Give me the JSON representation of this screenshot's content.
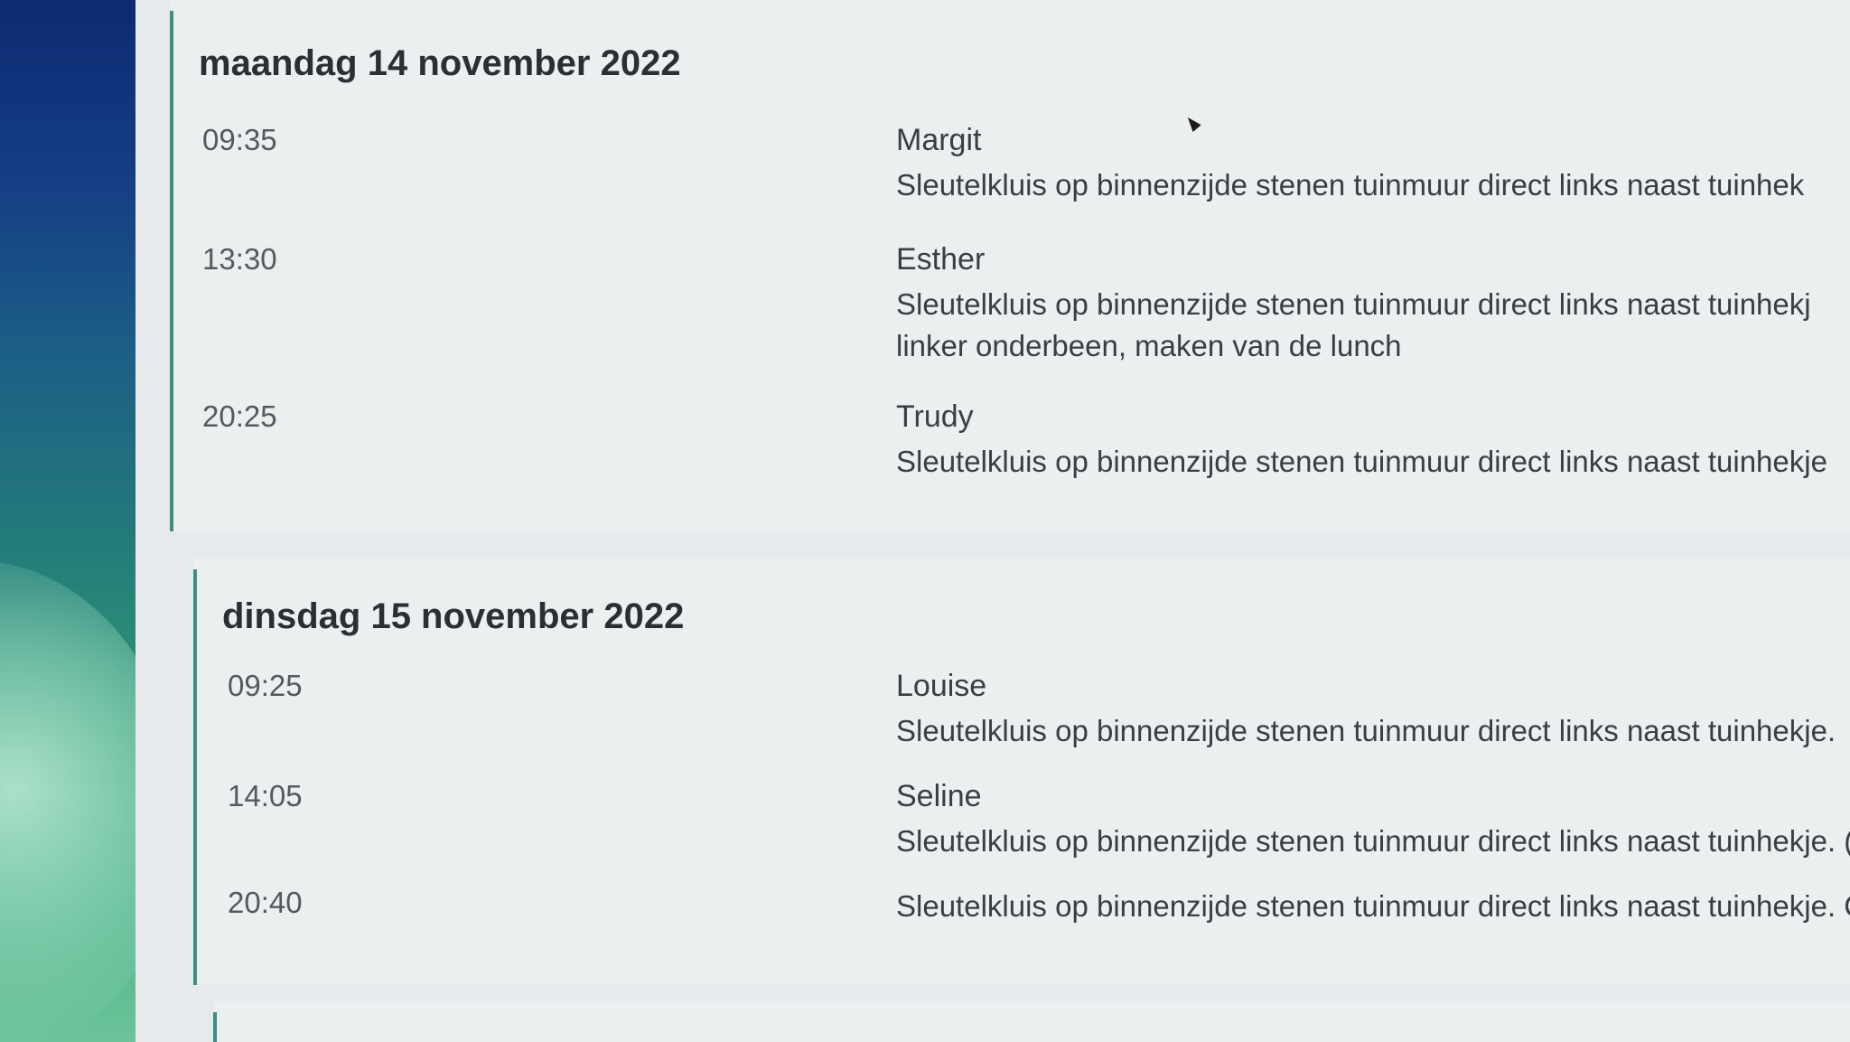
{
  "days": [
    {
      "title": "maandag 14 november 2022",
      "appointments": [
        {
          "time": "09:35",
          "name": "Margit",
          "lines": [
            "Sleutelkluis op binnenzijde stenen tuinmuur direct links naast tuinhek"
          ]
        },
        {
          "time": "13:30",
          "name": "Esther",
          "lines": [
            "Sleutelkluis op binnenzijde stenen tuinmuur direct links naast tuinhekj",
            "linker onderbeen, maken van de lunch"
          ]
        },
        {
          "time": "20:25",
          "name": "Trudy",
          "lines": [
            "Sleutelkluis op binnenzijde stenen tuinmuur direct links naast tuinhekje"
          ]
        }
      ]
    },
    {
      "title": "dinsdag 15 november 2022",
      "appointments": [
        {
          "time": "09:25",
          "name": "Louise",
          "lines": [
            "Sleutelkluis op binnenzijde stenen tuinmuur direct links naast tuinhekje."
          ]
        },
        {
          "time": "14:05",
          "name": "Seline",
          "lines": [
            "Sleutelkluis op binnenzijde stenen tuinmuur direct links naast tuinhekje. ("
          ]
        },
        {
          "time": "20:40",
          "name": "",
          "lines": [
            "Sleutelkluis op binnenzijde stenen tuinmuur direct links naast tuinhekje. C"
          ]
        }
      ]
    }
  ]
}
